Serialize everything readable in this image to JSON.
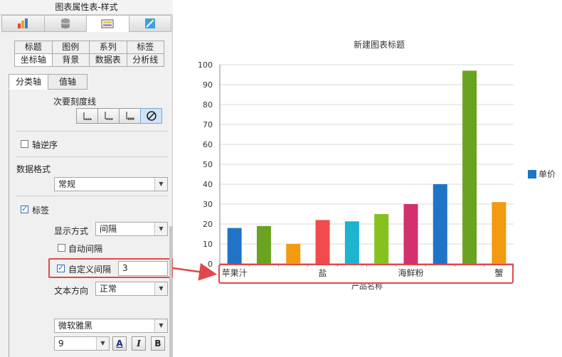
{
  "panel": {
    "title": "图表属性表-样式",
    "icon_tabs": [
      "chart-type-icon",
      "data-icon",
      "style-icon",
      "effects-icon"
    ],
    "grid_tabs_row1": [
      "标题",
      "图例",
      "系列",
      "标签"
    ],
    "grid_tabs_row2": [
      "坐标轴",
      "背景",
      "数据表",
      "分析线"
    ],
    "axis_tabs": [
      "分类轴",
      "值轴"
    ],
    "minor_tick_label": "次要刻度线",
    "reverse_axis_label": "轴逆序",
    "data_format_label": "数据格式",
    "data_format_value": "常规",
    "label_section": "标签",
    "display_mode_label": "显示方式",
    "display_mode_value": "间隔",
    "auto_interval_label": "自动间隔",
    "custom_interval_label": "自定义间隔",
    "custom_interval_value": "3",
    "text_direction_label": "文本方向",
    "text_direction_value": "正常",
    "font_value": "微软雅黑",
    "font_size_value": "9",
    "bold_label": "B",
    "italic_label": "I",
    "font_color_label": "A"
  },
  "chart_data": {
    "type": "bar",
    "title": "新建图表标题",
    "xlabel": "产品名称",
    "ylabel": "",
    "ylim": [
      0,
      100
    ],
    "yticks": [
      0,
      10,
      20,
      30,
      40,
      50,
      60,
      70,
      80,
      90,
      100
    ],
    "visible_category_labels": [
      "苹果汁",
      "盐",
      "海鲜粉",
      "蟹"
    ],
    "series": [
      {
        "name": "单价",
        "values": [
          18,
          19,
          10,
          22,
          21.35,
          25,
          30,
          40,
          97,
          31
        ],
        "colors": [
          "#1f74c8",
          "#6aa31f",
          "#f39a10",
          "#f14b4b",
          "#1eb3cf",
          "#86c21e",
          "#d42f6e",
          "#1f74c8",
          "#6aa31f",
          "#f39a10"
        ]
      }
    ],
    "grid": true,
    "legend": "right",
    "legend_color": "#1f74c8"
  },
  "highlight_color": "#e0484a"
}
